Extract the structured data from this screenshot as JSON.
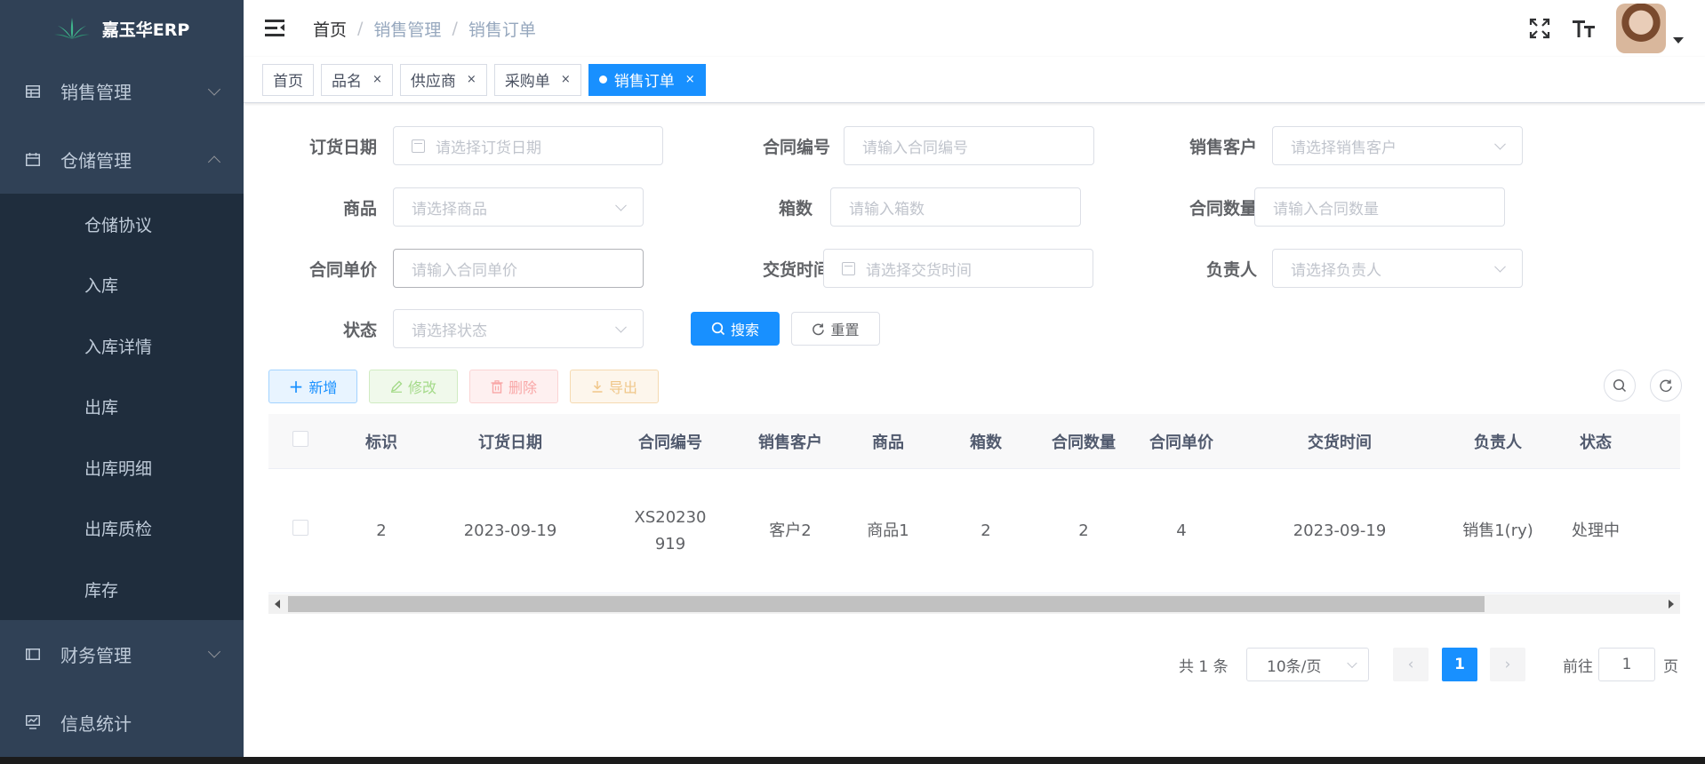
{
  "app": {
    "title": "嘉玉华ERP"
  },
  "sidebar": {
    "menus": [
      {
        "label": "销售管理",
        "icon": "table-icon",
        "expanded": false
      },
      {
        "label": "仓储管理",
        "icon": "calendar-icon",
        "expanded": true,
        "children": [
          "仓储协议",
          "入库",
          "入库详情",
          "出库",
          "出库明细",
          "出库质检",
          "库存"
        ]
      },
      {
        "label": "财务管理",
        "icon": "panel-icon",
        "expanded": false
      },
      {
        "label": "信息统计",
        "icon": "chart-icon",
        "expanded": false
      }
    ]
  },
  "breadcrumb": [
    "首页",
    "销售管理",
    "销售订单"
  ],
  "breadcrumb_sep": "/",
  "tags": [
    {
      "label": "首页",
      "closable": false
    },
    {
      "label": "品名",
      "closable": true
    },
    {
      "label": "供应商",
      "closable": true
    },
    {
      "label": "采购单",
      "closable": true
    },
    {
      "label": "销售订单",
      "closable": true,
      "active": true
    }
  ],
  "tag_close": "×",
  "search": {
    "order_date": {
      "label": "订货日期",
      "placeholder": "请选择订货日期"
    },
    "contract_no": {
      "label": "合同编号",
      "placeholder": "请输入合同编号"
    },
    "customer": {
      "label": "销售客户",
      "placeholder": "请选择销售客户"
    },
    "product": {
      "label": "商品",
      "placeholder": "请选择商品"
    },
    "boxes": {
      "label": "箱数",
      "placeholder": "请输入箱数"
    },
    "contract_qty": {
      "label": "合同数量",
      "placeholder": "请输入合同数量"
    },
    "unit_price": {
      "label": "合同单价",
      "placeholder": "请输入合同单价"
    },
    "delivery_time": {
      "label": "交货时间",
      "placeholder": "请选择交货时间"
    },
    "owner": {
      "label": "负责人",
      "placeholder": "请选择负责人"
    },
    "status": {
      "label": "状态",
      "placeholder": "请选择状态"
    },
    "search_btn": "搜索",
    "reset_btn": "重置"
  },
  "toolbar": {
    "add": "新增",
    "edit": "修改",
    "delete": "删除",
    "export": "导出"
  },
  "table": {
    "columns": [
      "标识",
      "订货日期",
      "合同编号",
      "销售客户",
      "商品",
      "箱数",
      "合同数量",
      "合同单价",
      "交货时间",
      "负责人",
      "状态"
    ],
    "rows": [
      {
        "id": "2",
        "order_date": "2023-09-19",
        "contract_no_1": "XS20230",
        "contract_no_2": "919",
        "customer": "客户2",
        "product": "商品1",
        "boxes": "2",
        "qty": "2",
        "price": "4",
        "delivery": "2023-09-19",
        "owner": "销售1(ry)",
        "status": "处理中"
      }
    ]
  },
  "pagination": {
    "total": "共 1 条",
    "page_size": "10条/页",
    "current": "1",
    "goto_label": "前往",
    "goto_value": "1",
    "page_label": "页"
  },
  "colors": {
    "sidebar_bg": "#304156",
    "submenu_bg": "#1f2d3d",
    "primary": "#1890ff"
  }
}
